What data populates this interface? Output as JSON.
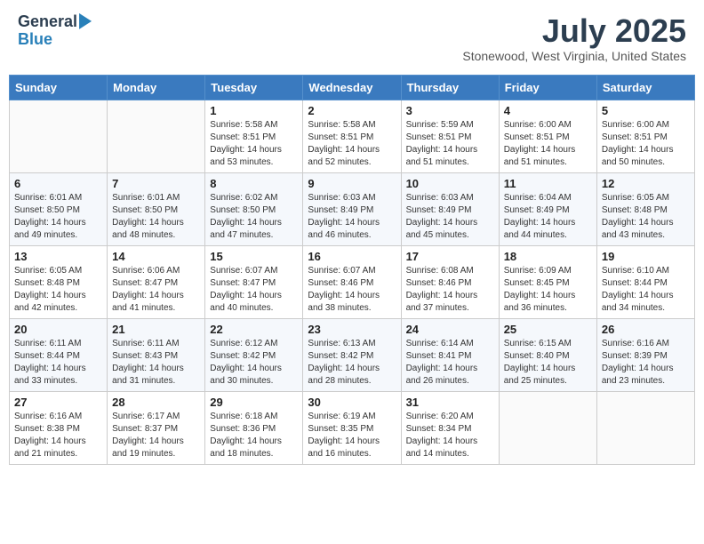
{
  "header": {
    "logo_general": "General",
    "logo_blue": "Blue",
    "title": "July 2025",
    "location": "Stonewood, West Virginia, United States"
  },
  "days_of_week": [
    "Sunday",
    "Monday",
    "Tuesday",
    "Wednesday",
    "Thursday",
    "Friday",
    "Saturday"
  ],
  "weeks": [
    [
      {
        "day": "",
        "sunrise": "",
        "sunset": "",
        "daylight": ""
      },
      {
        "day": "",
        "sunrise": "",
        "sunset": "",
        "daylight": ""
      },
      {
        "day": "1",
        "sunrise": "Sunrise: 5:58 AM",
        "sunset": "Sunset: 8:51 PM",
        "daylight": "Daylight: 14 hours and 53 minutes."
      },
      {
        "day": "2",
        "sunrise": "Sunrise: 5:58 AM",
        "sunset": "Sunset: 8:51 PM",
        "daylight": "Daylight: 14 hours and 52 minutes."
      },
      {
        "day": "3",
        "sunrise": "Sunrise: 5:59 AM",
        "sunset": "Sunset: 8:51 PM",
        "daylight": "Daylight: 14 hours and 51 minutes."
      },
      {
        "day": "4",
        "sunrise": "Sunrise: 6:00 AM",
        "sunset": "Sunset: 8:51 PM",
        "daylight": "Daylight: 14 hours and 51 minutes."
      },
      {
        "day": "5",
        "sunrise": "Sunrise: 6:00 AM",
        "sunset": "Sunset: 8:51 PM",
        "daylight": "Daylight: 14 hours and 50 minutes."
      }
    ],
    [
      {
        "day": "6",
        "sunrise": "Sunrise: 6:01 AM",
        "sunset": "Sunset: 8:50 PM",
        "daylight": "Daylight: 14 hours and 49 minutes."
      },
      {
        "day": "7",
        "sunrise": "Sunrise: 6:01 AM",
        "sunset": "Sunset: 8:50 PM",
        "daylight": "Daylight: 14 hours and 48 minutes."
      },
      {
        "day": "8",
        "sunrise": "Sunrise: 6:02 AM",
        "sunset": "Sunset: 8:50 PM",
        "daylight": "Daylight: 14 hours and 47 minutes."
      },
      {
        "day": "9",
        "sunrise": "Sunrise: 6:03 AM",
        "sunset": "Sunset: 8:49 PM",
        "daylight": "Daylight: 14 hours and 46 minutes."
      },
      {
        "day": "10",
        "sunrise": "Sunrise: 6:03 AM",
        "sunset": "Sunset: 8:49 PM",
        "daylight": "Daylight: 14 hours and 45 minutes."
      },
      {
        "day": "11",
        "sunrise": "Sunrise: 6:04 AM",
        "sunset": "Sunset: 8:49 PM",
        "daylight": "Daylight: 14 hours and 44 minutes."
      },
      {
        "day": "12",
        "sunrise": "Sunrise: 6:05 AM",
        "sunset": "Sunset: 8:48 PM",
        "daylight": "Daylight: 14 hours and 43 minutes."
      }
    ],
    [
      {
        "day": "13",
        "sunrise": "Sunrise: 6:05 AM",
        "sunset": "Sunset: 8:48 PM",
        "daylight": "Daylight: 14 hours and 42 minutes."
      },
      {
        "day": "14",
        "sunrise": "Sunrise: 6:06 AM",
        "sunset": "Sunset: 8:47 PM",
        "daylight": "Daylight: 14 hours and 41 minutes."
      },
      {
        "day": "15",
        "sunrise": "Sunrise: 6:07 AM",
        "sunset": "Sunset: 8:47 PM",
        "daylight": "Daylight: 14 hours and 40 minutes."
      },
      {
        "day": "16",
        "sunrise": "Sunrise: 6:07 AM",
        "sunset": "Sunset: 8:46 PM",
        "daylight": "Daylight: 14 hours and 38 minutes."
      },
      {
        "day": "17",
        "sunrise": "Sunrise: 6:08 AM",
        "sunset": "Sunset: 8:46 PM",
        "daylight": "Daylight: 14 hours and 37 minutes."
      },
      {
        "day": "18",
        "sunrise": "Sunrise: 6:09 AM",
        "sunset": "Sunset: 8:45 PM",
        "daylight": "Daylight: 14 hours and 36 minutes."
      },
      {
        "day": "19",
        "sunrise": "Sunrise: 6:10 AM",
        "sunset": "Sunset: 8:44 PM",
        "daylight": "Daylight: 14 hours and 34 minutes."
      }
    ],
    [
      {
        "day": "20",
        "sunrise": "Sunrise: 6:11 AM",
        "sunset": "Sunset: 8:44 PM",
        "daylight": "Daylight: 14 hours and 33 minutes."
      },
      {
        "day": "21",
        "sunrise": "Sunrise: 6:11 AM",
        "sunset": "Sunset: 8:43 PM",
        "daylight": "Daylight: 14 hours and 31 minutes."
      },
      {
        "day": "22",
        "sunrise": "Sunrise: 6:12 AM",
        "sunset": "Sunset: 8:42 PM",
        "daylight": "Daylight: 14 hours and 30 minutes."
      },
      {
        "day": "23",
        "sunrise": "Sunrise: 6:13 AM",
        "sunset": "Sunset: 8:42 PM",
        "daylight": "Daylight: 14 hours and 28 minutes."
      },
      {
        "day": "24",
        "sunrise": "Sunrise: 6:14 AM",
        "sunset": "Sunset: 8:41 PM",
        "daylight": "Daylight: 14 hours and 26 minutes."
      },
      {
        "day": "25",
        "sunrise": "Sunrise: 6:15 AM",
        "sunset": "Sunset: 8:40 PM",
        "daylight": "Daylight: 14 hours and 25 minutes."
      },
      {
        "day": "26",
        "sunrise": "Sunrise: 6:16 AM",
        "sunset": "Sunset: 8:39 PM",
        "daylight": "Daylight: 14 hours and 23 minutes."
      }
    ],
    [
      {
        "day": "27",
        "sunrise": "Sunrise: 6:16 AM",
        "sunset": "Sunset: 8:38 PM",
        "daylight": "Daylight: 14 hours and 21 minutes."
      },
      {
        "day": "28",
        "sunrise": "Sunrise: 6:17 AM",
        "sunset": "Sunset: 8:37 PM",
        "daylight": "Daylight: 14 hours and 19 minutes."
      },
      {
        "day": "29",
        "sunrise": "Sunrise: 6:18 AM",
        "sunset": "Sunset: 8:36 PM",
        "daylight": "Daylight: 14 hours and 18 minutes."
      },
      {
        "day": "30",
        "sunrise": "Sunrise: 6:19 AM",
        "sunset": "Sunset: 8:35 PM",
        "daylight": "Daylight: 14 hours and 16 minutes."
      },
      {
        "day": "31",
        "sunrise": "Sunrise: 6:20 AM",
        "sunset": "Sunset: 8:34 PM",
        "daylight": "Daylight: 14 hours and 14 minutes."
      },
      {
        "day": "",
        "sunrise": "",
        "sunset": "",
        "daylight": ""
      },
      {
        "day": "",
        "sunrise": "",
        "sunset": "",
        "daylight": ""
      }
    ]
  ]
}
